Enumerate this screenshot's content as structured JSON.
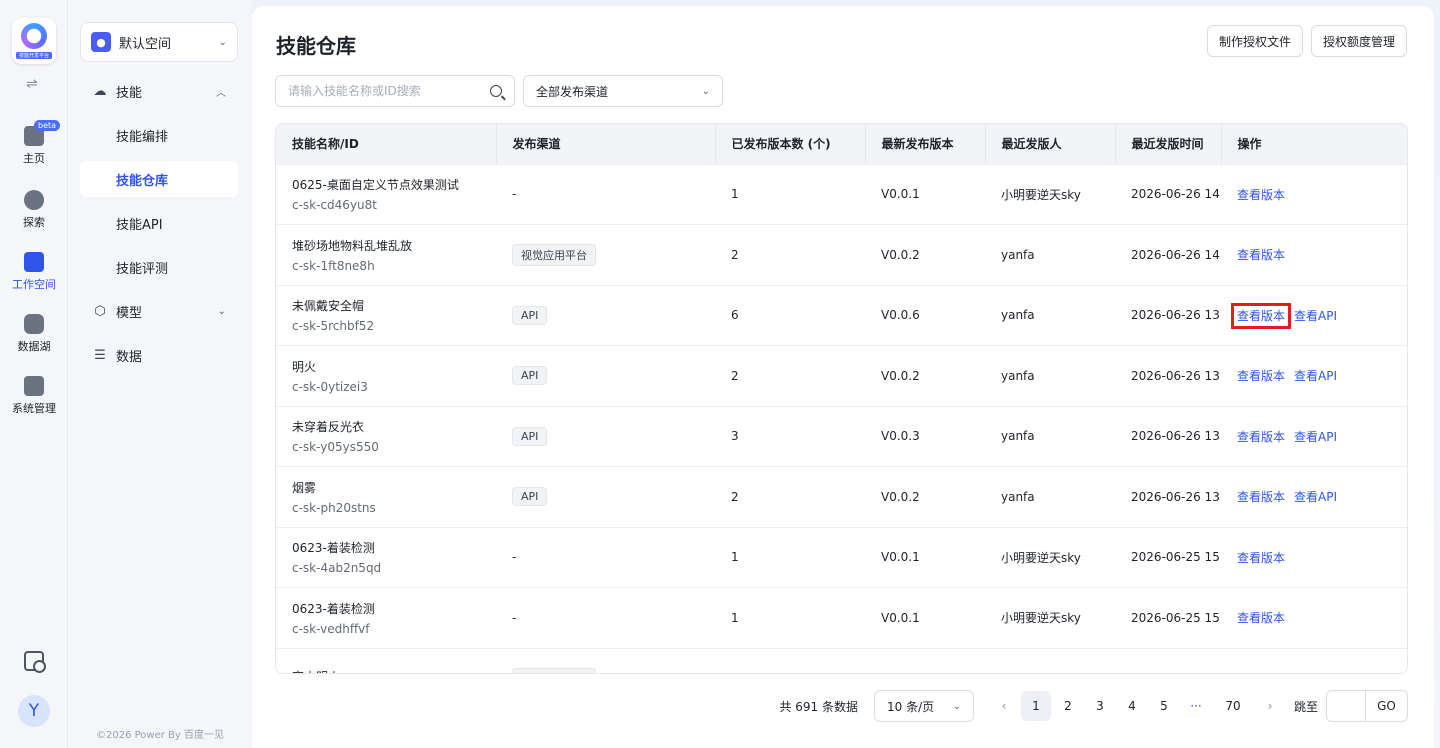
{
  "rail": {
    "logo_caption": "技能开发平台",
    "items": [
      {
        "label": "主页",
        "badge": "beta"
      },
      {
        "label": "探索"
      },
      {
        "label": "工作空间"
      },
      {
        "label": "数据湖"
      },
      {
        "label": "系统管理"
      }
    ],
    "avatar": "Y"
  },
  "nav": {
    "space": "默认空间",
    "groups": [
      {
        "label": "技能"
      },
      {
        "label": "模型"
      },
      {
        "label": "数据"
      }
    ],
    "subs": [
      "技能编排",
      "技能仓库",
      "技能API",
      "技能评测"
    ],
    "footer": "©2026 Power By 百度一见"
  },
  "header": {
    "title": "技能仓库",
    "btn_license": "制作授权文件",
    "btn_quota": "授权额度管理"
  },
  "filters": {
    "search_placeholder": "请输入技能名称或ID搜索",
    "channel_select": "全部发布渠道"
  },
  "table": {
    "columns": [
      "技能名称/ID",
      "发布渠道",
      "已发布版本数 (个)",
      "最新发布版本",
      "最近发版人",
      "最近发版时间",
      "操作"
    ],
    "rows": [
      {
        "name": "0625-桌面自定义节点效果测试",
        "id": "c-sk-cd46yu8t",
        "channel": "-",
        "count": "1",
        "version": "V0.0.1",
        "publisher": "小明要逆天sky",
        "time": "2026-06-26 14:",
        "ops": [
          "查看版本"
        ]
      },
      {
        "name": "堆砂场地物料乱堆乱放",
        "id": "c-sk-1ft8ne8h",
        "channel": "视觉应用平台",
        "count": "2",
        "version": "V0.0.2",
        "publisher": "yanfa",
        "time": "2026-06-26 14:",
        "ops": [
          "查看版本"
        ]
      },
      {
        "name": "未佩戴安全帽",
        "id": "c-sk-5rchbf52",
        "channel": "API",
        "count": "6",
        "version": "V0.0.6",
        "publisher": "yanfa",
        "time": "2026-06-26 13:",
        "ops": [
          "查看版本",
          "查看API"
        ]
      },
      {
        "name": "明火",
        "id": "c-sk-0ytizei3",
        "channel": "API",
        "count": "2",
        "version": "V0.0.2",
        "publisher": "yanfa",
        "time": "2026-06-26 13:",
        "ops": [
          "查看版本",
          "查看API"
        ]
      },
      {
        "name": "未穿着反光衣",
        "id": "c-sk-y05ys550",
        "channel": "API",
        "count": "3",
        "version": "V0.0.3",
        "publisher": "yanfa",
        "time": "2026-06-26 13:",
        "ops": [
          "查看版本",
          "查看API"
        ]
      },
      {
        "name": "烟雾",
        "id": "c-sk-ph20stns",
        "channel": "API",
        "count": "2",
        "version": "V0.0.2",
        "publisher": "yanfa",
        "time": "2026-06-26 13:",
        "ops": [
          "查看版本",
          "查看API"
        ]
      },
      {
        "name": "0623-着装检测",
        "id": "c-sk-4ab2n5qd",
        "channel": "-",
        "count": "1",
        "version": "V0.0.1",
        "publisher": "小明要逆天sky",
        "time": "2026-06-25 15:",
        "ops": [
          "查看版本"
        ]
      },
      {
        "name": "0623-着装检测",
        "id": "c-sk-vedhffvf",
        "channel": "-",
        "count": "1",
        "version": "V0.0.1",
        "publisher": "小明要逆天sky",
        "time": "2026-06-25 15:",
        "ops": [
          "查看版本"
        ]
      },
      {
        "name": "室内明火",
        "id": "",
        "channel": "视觉应用平台",
        "count": "",
        "version": "",
        "publisher": "",
        "time": "",
        "ops": []
      }
    ]
  },
  "pagination": {
    "total": "共 691 条数据",
    "page_size": "10 条/页",
    "pages": [
      "1",
      "2",
      "3",
      "4",
      "5",
      "···",
      "70"
    ],
    "jump_label": "跳至",
    "go": "GO"
  },
  "colors": {
    "accent": "#2f54eb",
    "highlight": "#e02020"
  }
}
